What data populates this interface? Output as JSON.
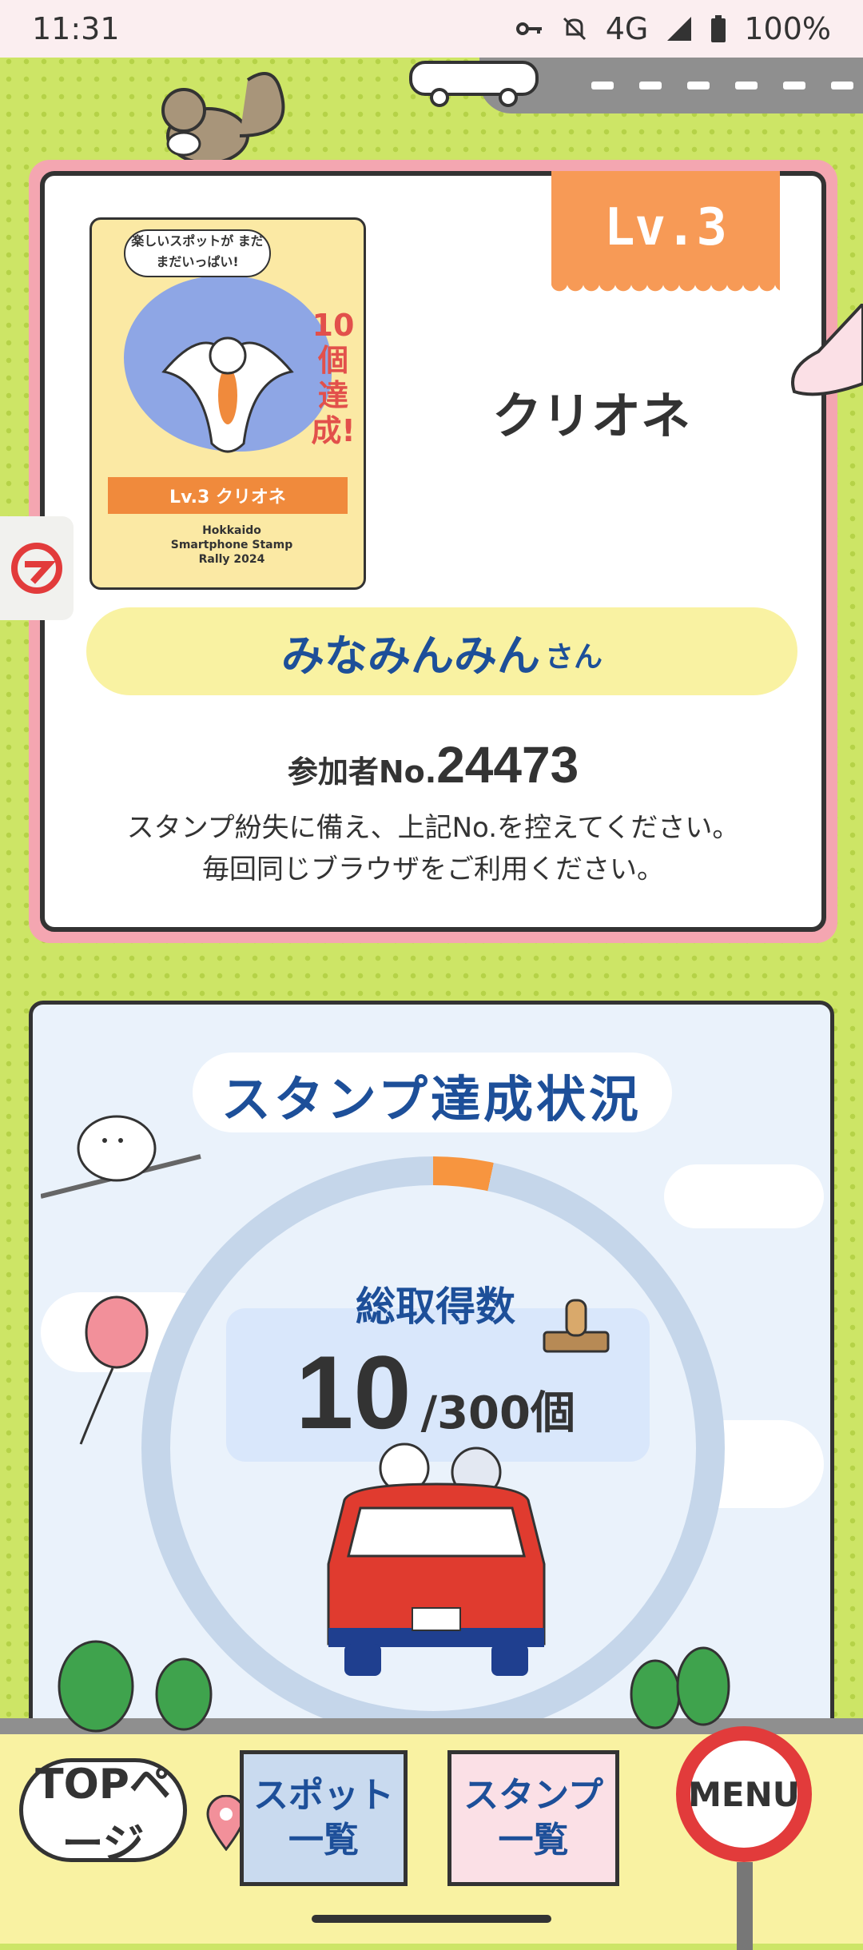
{
  "status_bar": {
    "time": "11:31",
    "network": "4G",
    "battery": "100%",
    "icons": [
      "key-icon",
      "mute-icon",
      "signal-icon",
      "battery-icon"
    ]
  },
  "profile_card": {
    "level_badge": "Lv.3",
    "level_name": "クリオネ",
    "stamp_card": {
      "bubble_text": "楽しいスポットが まだまだいっぱい!",
      "count_text": "10個達成!",
      "ribbon_text": "Lv.3 クリオネ",
      "footer_text": "Hokkaido Smartphone Stamp Rally 2024"
    },
    "user_name": "みなみんみん",
    "user_suffix": "さん",
    "participant_label": "参加者No.",
    "participant_number": "24473",
    "note_line1": "スタンプ紛失に備え、上記No.を控えてください。",
    "note_line2": "毎回同じブラウザをご利用ください。"
  },
  "stamp_status": {
    "title": "スタンプ達成状況",
    "total_label": "総取得数",
    "count": "10",
    "total": "/300個",
    "progress": 0.0333
  },
  "bottom_nav": {
    "top_label": "TOPページ",
    "spot_label": "スポット一覧",
    "stamp_label": "スタンプ一覧",
    "menu_label": "MENU"
  },
  "colors": {
    "background": "#cde566",
    "accent_blue": "#1d4f99",
    "orange": "#f79a56",
    "pink": "#f4a6b1"
  }
}
